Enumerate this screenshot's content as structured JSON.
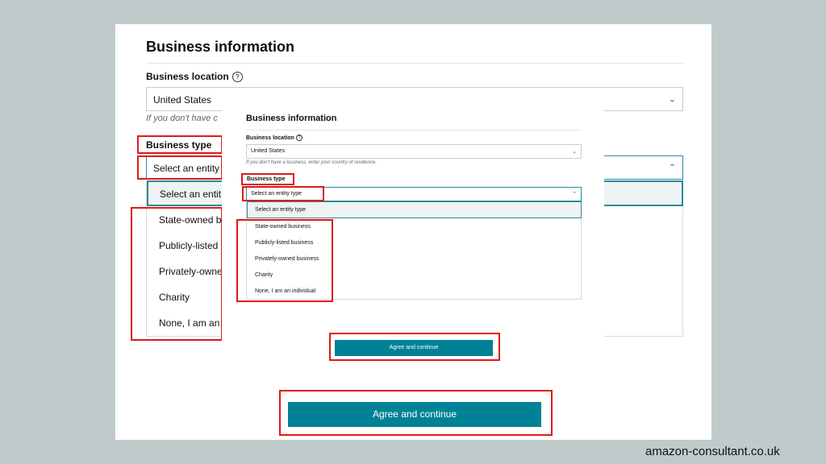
{
  "colors": {
    "background": "#bfcbcb",
    "accent": "#008296",
    "focus_border": "#2b8a99",
    "highlight_box": "#e01818"
  },
  "main_form": {
    "title": "Business information",
    "location_label": "Business location",
    "location_value": "United States",
    "location_hint": "If you don't have c",
    "type_label": "Business type",
    "type_value": "Select an entity",
    "options": [
      "Select an entit",
      "State-owned b",
      "Publicly-listed",
      "Privately-owne",
      "Charity",
      "None, I am an i"
    ],
    "button_label": "Agree and continue"
  },
  "inset_form": {
    "title": "Business information",
    "location_label": "Business location",
    "location_value": "United States",
    "location_hint": "If you don't have a business, enter your country of residence.",
    "type_label": "Business type",
    "type_value": "Select an entity type",
    "options": [
      "Select an entity type",
      "State-owned business",
      "Publicly-listed business",
      "Privately-owned business",
      "Charity",
      "None, I am an individual"
    ],
    "button_label": "Agree and continue"
  },
  "icons": {
    "help": "help-circle-icon",
    "chevron_down": "chevron-down-icon",
    "chevron_up": "chevron-up-icon"
  },
  "footer": {
    "site": "amazon-consultant.co.uk"
  }
}
